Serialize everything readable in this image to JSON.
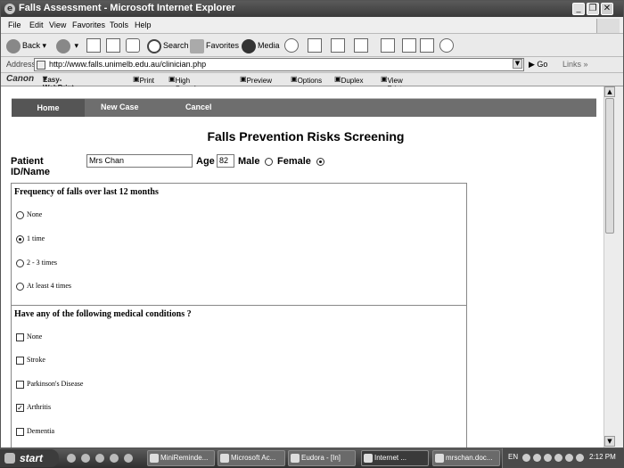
{
  "window": {
    "title": "Falls Assessment - Microsoft Internet Explorer",
    "ie_glyph": "e",
    "minimize": "_",
    "restore": "❐",
    "close": "✕"
  },
  "menu": [
    "File",
    "Edit",
    "View",
    "Favorites",
    "Tools",
    "Help"
  ],
  "toolbar": {
    "back": "Back",
    "search": "Search",
    "favorites": "Favorites",
    "media": "Media"
  },
  "address": {
    "label": "Address",
    "url": "http://www.falls.unimelb.edu.au/clinician.php",
    "go": "Go",
    "links": "Links"
  },
  "canon": {
    "brand": "Canon",
    "product": "Easy-WebPrint",
    "print": "Print",
    "high_speed": "High Speed Print",
    "preview": "Preview",
    "options": "Options",
    "duplex": "Duplex",
    "view_list": "View Print List"
  },
  "nav": {
    "home": "Home",
    "new_case": "New Case",
    "cancel": "Cancel"
  },
  "page": {
    "title": "Falls Prevention Risks Screening",
    "patient_label": "Patient ID/Name",
    "patient_value": "Mrs Chan",
    "age_label": "Age",
    "age_value": "82",
    "male_label": "Male",
    "female_label": "Female",
    "gender_selected": "Female"
  },
  "falls_section": {
    "heading": "Frequency of falls over last 12 months",
    "options": [
      {
        "label": "None",
        "selected": false
      },
      {
        "label": "1 time",
        "selected": true
      },
      {
        "label": "2 - 3 times",
        "selected": false
      },
      {
        "label": "At least 4 times",
        "selected": false
      }
    ]
  },
  "conditions_section": {
    "heading": "Have any of the following medical conditions ?",
    "options": [
      {
        "label": "None",
        "checked": false
      },
      {
        "label": "Stroke",
        "checked": false
      },
      {
        "label": "Parkinson's Disease",
        "checked": false
      },
      {
        "label": "Arthritis",
        "checked": true
      },
      {
        "label": "Dementia",
        "checked": false
      }
    ]
  },
  "taskbar": {
    "start": "start",
    "tasks": [
      "MiniReminde...",
      "Microsoft Ac...",
      "Eudora - [In]",
      "Internet ...",
      "mrschan.doc..."
    ],
    "lang": "EN",
    "clock": "2:12 PM"
  }
}
